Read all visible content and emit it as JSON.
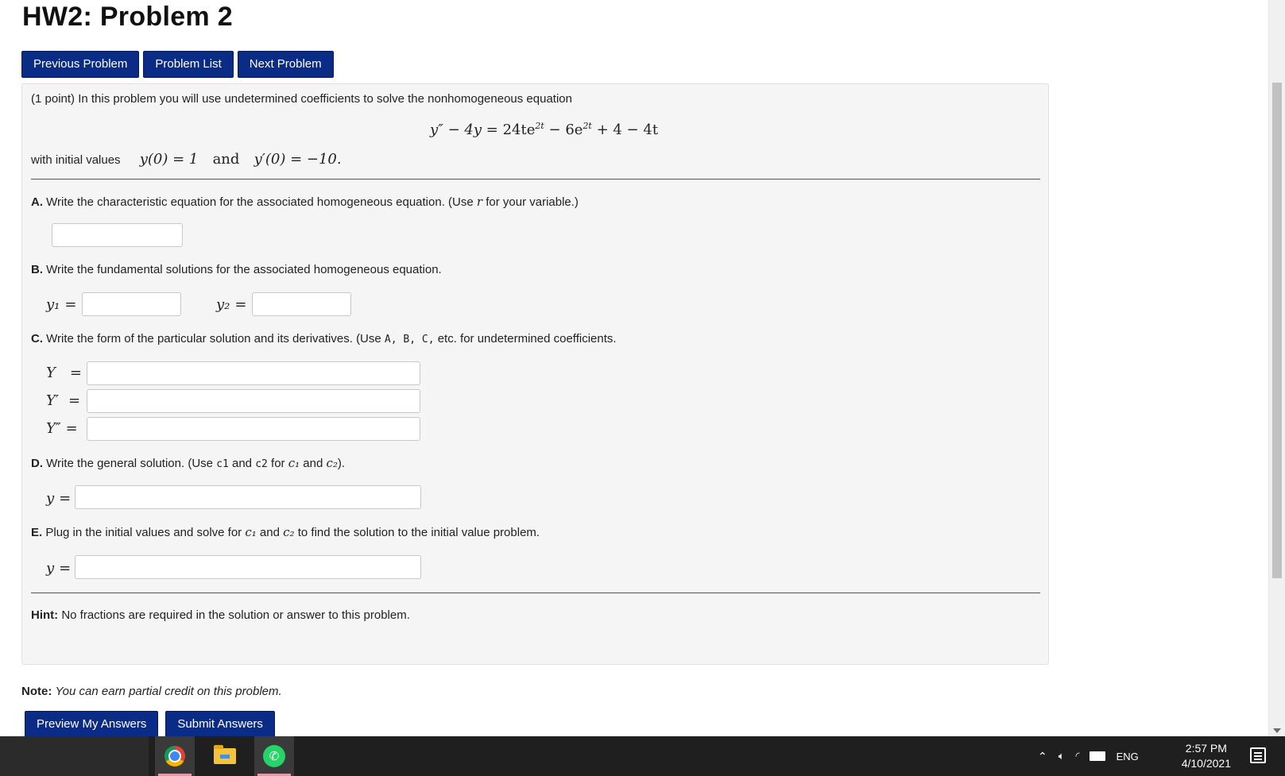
{
  "page": {
    "title": "HW2: Problem 2"
  },
  "nav": {
    "previous": "Previous Problem",
    "list": "Problem List",
    "next": "Next Problem"
  },
  "problem": {
    "intro": "(1 point) In this problem you will use undetermined coefficients to solve the nonhomogeneous equation",
    "equation_lhs": "y″ − 4y",
    "equation_rhs": "= 24te",
    "equation_exp1": "2t",
    "equation_mid": " − 6e",
    "equation_exp2": "2t",
    "equation_tail": " + 4 − 4t",
    "initial_prefix": "with initial values",
    "initial_cond1": "y(0) = 1",
    "initial_and": "and",
    "initial_cond2": "y′(0) = −10."
  },
  "partA": {
    "label": "A.",
    "text": " Write the characteristic equation for the associated homogeneous equation. (Use ",
    "var": "r",
    "text_end": " for your variable.)",
    "value": ""
  },
  "partB": {
    "label": "B.",
    "text": " Write the fundamental solutions for the associated homogeneous equation.",
    "y1_label": "y₁",
    "y2_label": "y₂",
    "y1_value": "",
    "y2_value": ""
  },
  "partC": {
    "label": "C.",
    "text": " Write the form of the particular solution and its derivatives. (Use ",
    "vars": "A, B, C,",
    "text_end": " etc. for undetermined coefficients.",
    "Y_label": "Y",
    "Yp_label": "Y′",
    "Ypp_label": "Y″",
    "Y_value": "",
    "Yp_value": "",
    "Ypp_value": ""
  },
  "partD": {
    "label": "D.",
    "text": " Write the general solution. (Use ",
    "c1_code": "c1",
    "and1": " and ",
    "c2_code": "c2",
    "for_text": " for ",
    "c1_math": "c₁",
    "and2": " and ",
    "c2_math": "c₂",
    "text_end": ").",
    "y_label": "y",
    "value": ""
  },
  "partE": {
    "label": "E.",
    "text": " Plug in the initial values and solve for ",
    "c1_math": "c₁",
    "and": " and ",
    "c2_math": "c₂",
    "text_end": " to find the solution to the initial value problem.",
    "y_label": "y",
    "value": ""
  },
  "hint": {
    "label": "Hint:",
    "text": " No fractions are required in the solution or answer to this problem."
  },
  "note": {
    "label": "Note:",
    "text": "You can earn partial credit on this problem."
  },
  "actions": {
    "preview": "Preview My Answers",
    "submit": "Submit Answers"
  },
  "taskbar": {
    "language": "ENG",
    "time": "2:57 PM",
    "date": "4/10/2021",
    "apps": [
      "chrome-icon",
      "file-explorer-icon",
      "whatsapp-icon"
    ]
  },
  "colors": {
    "button_bg": "#0b2c86",
    "panel_bg": "#f5f5f5",
    "taskbar_bg": "#1f1f1f"
  }
}
